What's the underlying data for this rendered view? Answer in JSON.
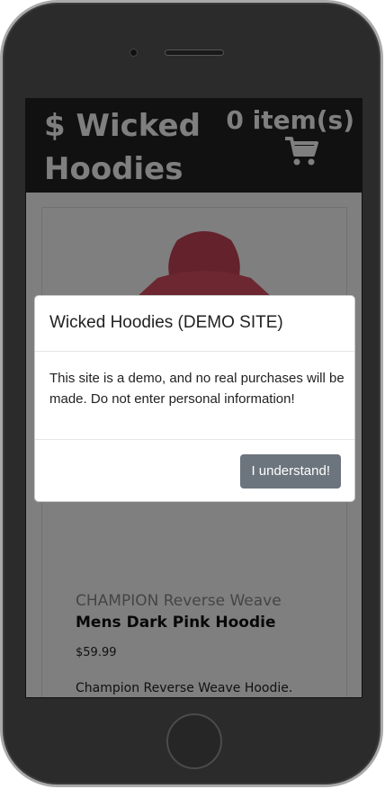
{
  "app": {
    "brand": "$ Wicked Hoodies",
    "cart_count": "0 item(s)"
  },
  "product": {
    "title_line1": "CHAMPION Reverse Weave",
    "title_line2": "Mens Dark Pink Hoodie",
    "price": "$59.99",
    "description": "Champion Reverse Weave Hoodie.",
    "image_color": "#d94f63"
  },
  "modal": {
    "title": "Wicked Hoodies (DEMO SITE)",
    "body": "This site is a demo, and no real purchases will be made. Do not enter personal information!",
    "button_label": "I understand!"
  },
  "colors": {
    "header_bg": "#222222",
    "button_bg": "#6c757d",
    "overlay": "rgba(0,0,0,0.5)"
  }
}
